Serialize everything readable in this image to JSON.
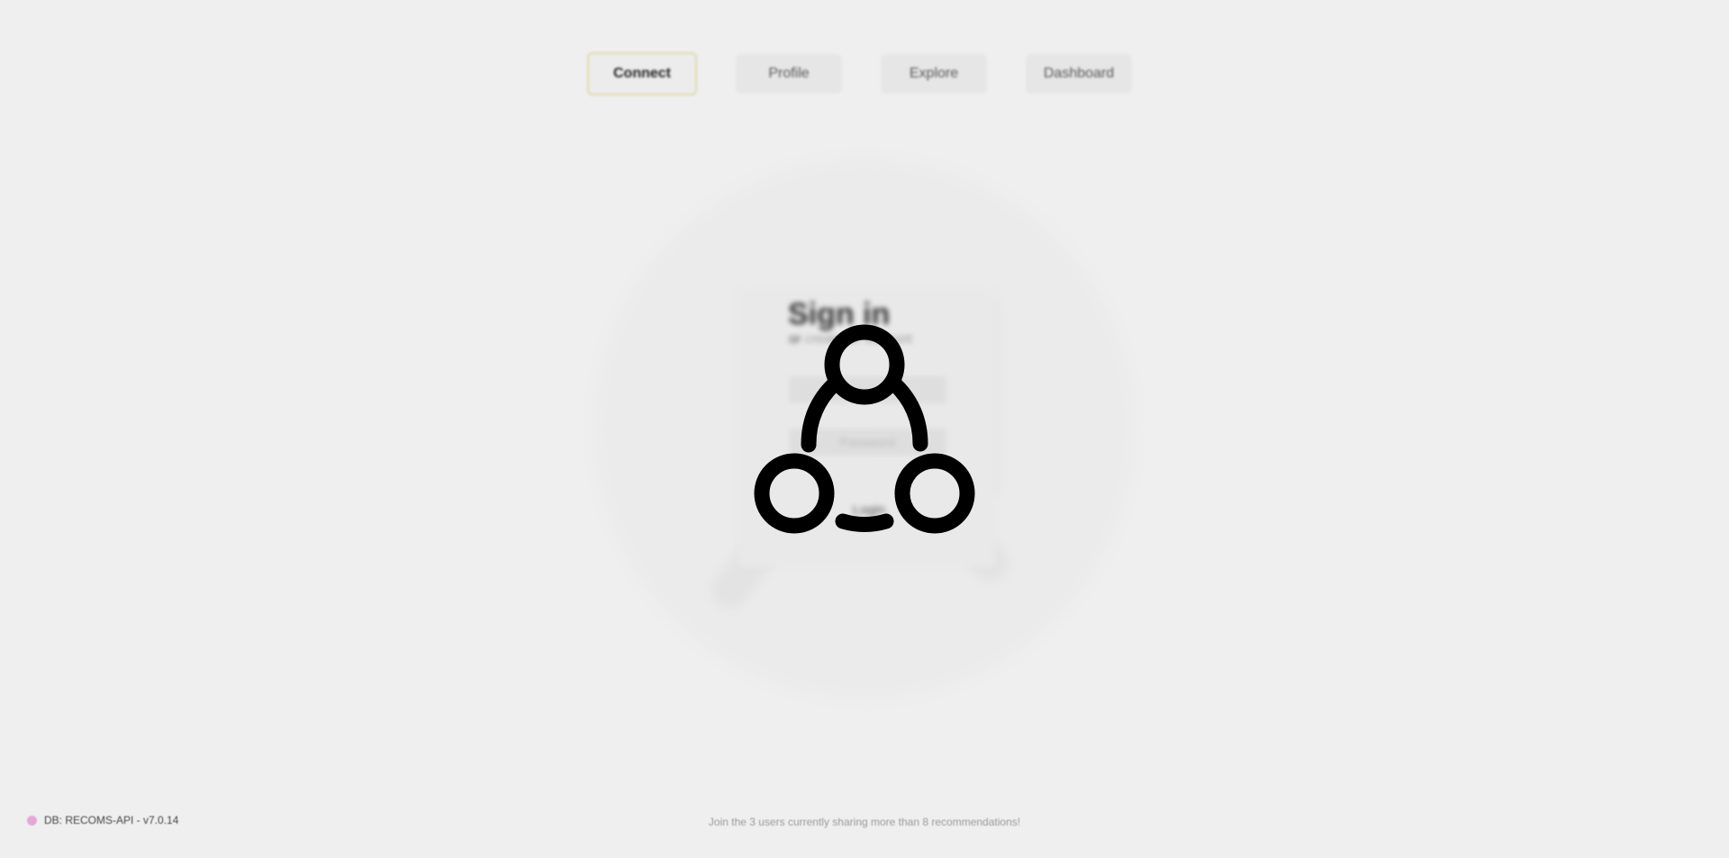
{
  "nav": {
    "tabs": [
      {
        "label": "Connect",
        "active": true
      },
      {
        "label": "Profile",
        "active": false
      },
      {
        "label": "Explore",
        "active": false
      },
      {
        "label": "Dashboard",
        "active": false
      }
    ]
  },
  "signin": {
    "title": "Sign in",
    "subtitle_prefix": "or",
    "subtitle_link": "create an account",
    "email_placeholder": "",
    "password_placeholder": "Password",
    "login_label": "Login"
  },
  "loader": {
    "icon": "community-loader-icon"
  },
  "footer": {
    "status_text": "DB: RECOMS-API - v7.0.14",
    "status_color": "#e4a7d8",
    "message": "Join the 3 users currently sharing more than 8 recommendations!"
  }
}
